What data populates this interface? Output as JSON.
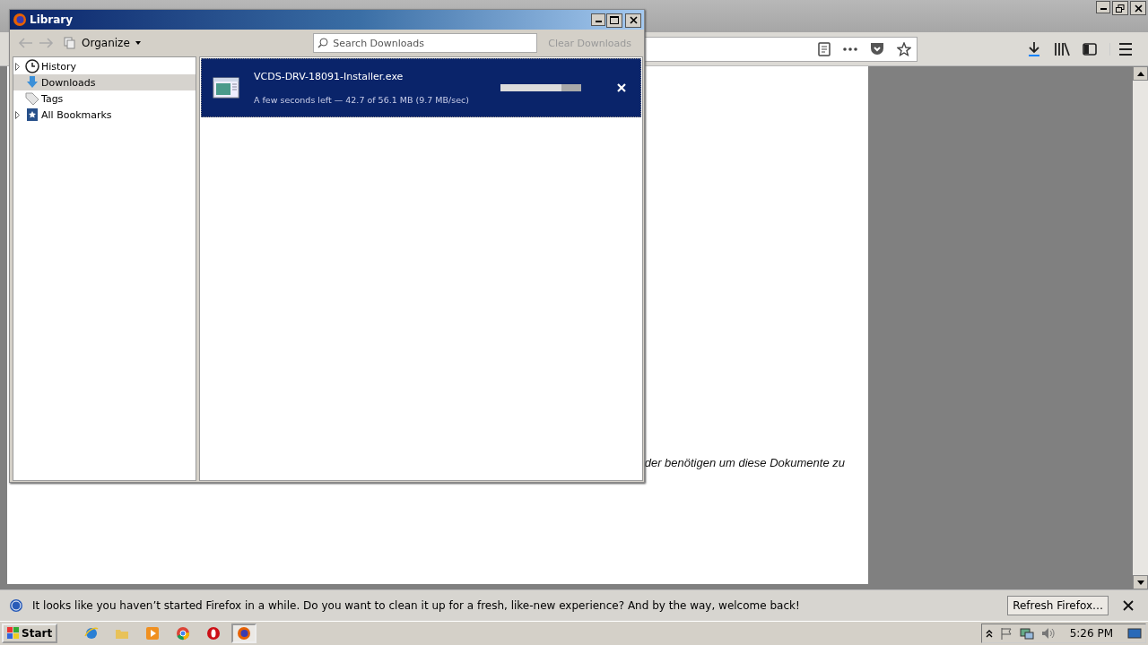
{
  "background_page": {
    "text": "der benötigen um diese Dokumente zu"
  },
  "library": {
    "title": "Library",
    "organize": "Organize",
    "search": {
      "placeholder": "Search Downloads"
    },
    "clear_button": {
      "label": "Clear Downloads",
      "disabled": true
    },
    "sidebar": [
      {
        "label": "History",
        "kind": "history",
        "expandable": true,
        "selected": false
      },
      {
        "label": "Downloads",
        "kind": "downloads",
        "expandable": false,
        "selected": true
      },
      {
        "label": "Tags",
        "kind": "tags",
        "expandable": false,
        "selected": false
      },
      {
        "label": "All Bookmarks",
        "kind": "bookmarks",
        "expandable": true,
        "selected": false
      }
    ],
    "downloads": [
      {
        "name": "VCDS-DRV-18091-Installer.exe",
        "status": "A few seconds left — 42.7 of 56.1 MB (9.7 MB/sec)",
        "level": 0.76,
        "selected": true
      }
    ]
  },
  "notification": {
    "message": "It looks like you haven’t started Firefox in a while. Do you want to clean it up for a fresh, like-new experience? And by the way, welcome back!",
    "button": "Refresh Firefox…"
  },
  "taskbar": {
    "start": "Start",
    "clock": "5:26 PM",
    "apps": [
      {
        "kind": "ie",
        "selected": false
      },
      {
        "kind": "folder",
        "selected": false
      },
      {
        "kind": "media",
        "selected": false
      },
      {
        "kind": "chrome",
        "selected": false
      },
      {
        "kind": "opera",
        "selected": false
      },
      {
        "kind": "firefox",
        "selected": true
      }
    ]
  }
}
